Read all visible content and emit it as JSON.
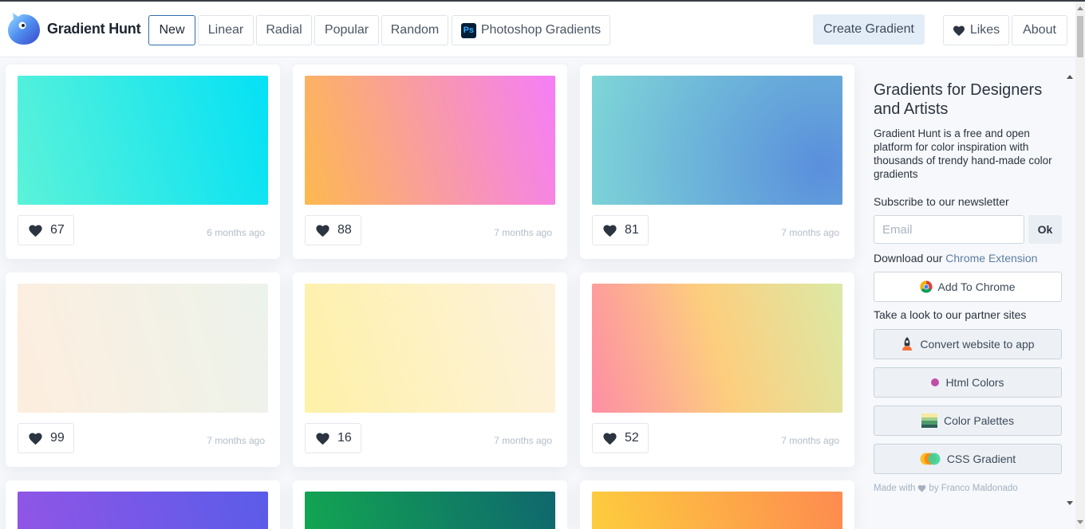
{
  "header": {
    "brand": "Gradient Hunt",
    "nav": [
      "New",
      "Linear",
      "Radial",
      "Popular",
      "Random"
    ],
    "photoshop_label": "Photoshop Gradients",
    "photoshop_icon_text": "Ps",
    "create_label": "Create Gradient",
    "likes_label": "Likes",
    "about_label": "About"
  },
  "cards": [
    {
      "likes": "67",
      "ago": "6 months ago",
      "colors": [
        "#5cf2d8",
        "#04e1f5"
      ],
      "kind": "linear"
    },
    {
      "likes": "88",
      "ago": "7 months ago",
      "colors": [
        "#fdb94f",
        "#f57ef7"
      ],
      "kind": "linear"
    },
    {
      "likes": "81",
      "ago": "7 months ago",
      "colors": [
        "#84e1d6",
        "#5a8fdc"
      ],
      "kind": "radial"
    },
    {
      "likes": "99",
      "ago": "7 months ago",
      "colors": [
        "#fdeede",
        "#ecf3ec"
      ],
      "kind": "linear"
    },
    {
      "likes": "16",
      "ago": "7 months ago",
      "colors": [
        "#fef1a8",
        "#fdf2de"
      ],
      "kind": "linear"
    },
    {
      "likes": "52",
      "ago": "7 months ago",
      "colors": [
        "#fd8ea5",
        "#fdce7e",
        "#dbe9a6"
      ],
      "kind": "linear"
    },
    {
      "likes": "",
      "ago": "",
      "colors": [
        "#9055e6",
        "#5a5ce9"
      ],
      "kind": "linear"
    },
    {
      "likes": "",
      "ago": "",
      "colors": [
        "#12a552",
        "#10676d"
      ],
      "kind": "linear"
    },
    {
      "likes": "",
      "ago": "",
      "colors": [
        "#fdcd3e",
        "#fd8b50"
      ],
      "kind": "linear"
    }
  ],
  "sidebar": {
    "title": "Gradients for Designers and Artists",
    "description": "Gradient Hunt is a free and open platform for color inspiration with thousands of trendy hand-made color gradients",
    "subscribe_label": "Subscribe to our newsletter",
    "email_placeholder": "Email",
    "ok_label": "Ok",
    "download_prefix": "Download our ",
    "download_link": "Chrome Extension",
    "chrome_button": "Add To Chrome",
    "partners_label": "Take a look to our partner sites",
    "partners": [
      "Convert website to app",
      "Html Colors",
      "Color Palettes",
      "CSS Gradient"
    ],
    "made_prefix": "Made with",
    "made_suffix": "by Franco Maldonado"
  },
  "icons": {
    "heart": "heart-icon",
    "chrome": "chrome-icon",
    "photoshop": "photoshop-icon"
  }
}
